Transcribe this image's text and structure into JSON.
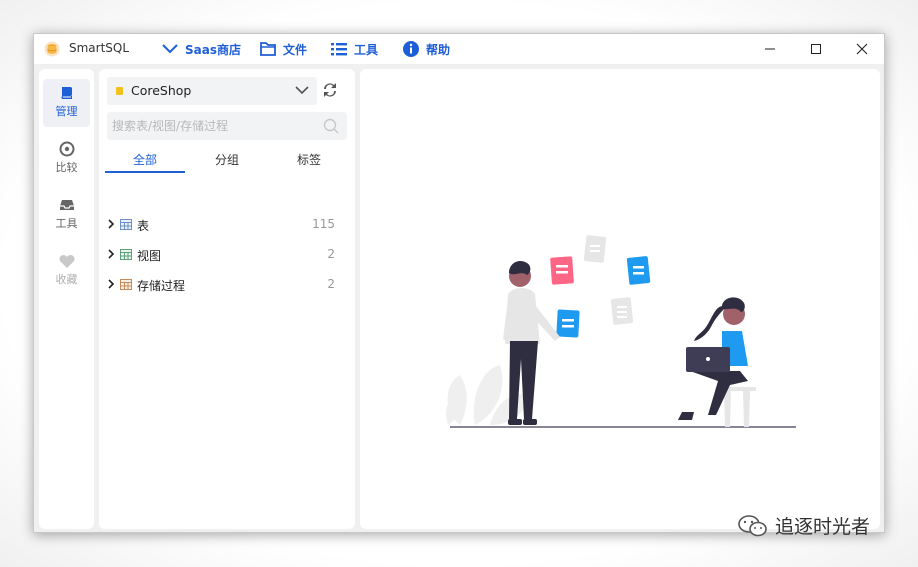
{
  "titlebar": {
    "app_title": "SmartSQL",
    "menus": [
      {
        "label": "Saas商店",
        "icon": "chevron-down-icon"
      },
      {
        "label": "文件",
        "icon": "folder-icon"
      },
      {
        "label": "工具",
        "icon": "list-icon"
      },
      {
        "label": "帮助",
        "icon": "info-icon"
      }
    ],
    "accent_color": "#1f5fd6"
  },
  "rail": {
    "items": [
      {
        "label": "管理",
        "icon": "book-icon",
        "active": true
      },
      {
        "label": "比较",
        "icon": "compass-icon",
        "active": false
      },
      {
        "label": "工具",
        "icon": "inbox-icon",
        "active": false
      },
      {
        "label": "收藏",
        "icon": "heart-icon",
        "active": false
      }
    ]
  },
  "tree": {
    "database": "CoreShop",
    "search_placeholder": "搜索表/视图/存储过程",
    "tabs": [
      "全部",
      "分组",
      "标签"
    ],
    "nodes": [
      {
        "label": "表",
        "count": "115",
        "icon": "table-icon"
      },
      {
        "label": "视图",
        "count": "2",
        "icon": "view-icon"
      },
      {
        "label": "存储过程",
        "count": "2",
        "icon": "procedure-icon"
      }
    ]
  },
  "watermark": {
    "text": "追逐时光者"
  }
}
